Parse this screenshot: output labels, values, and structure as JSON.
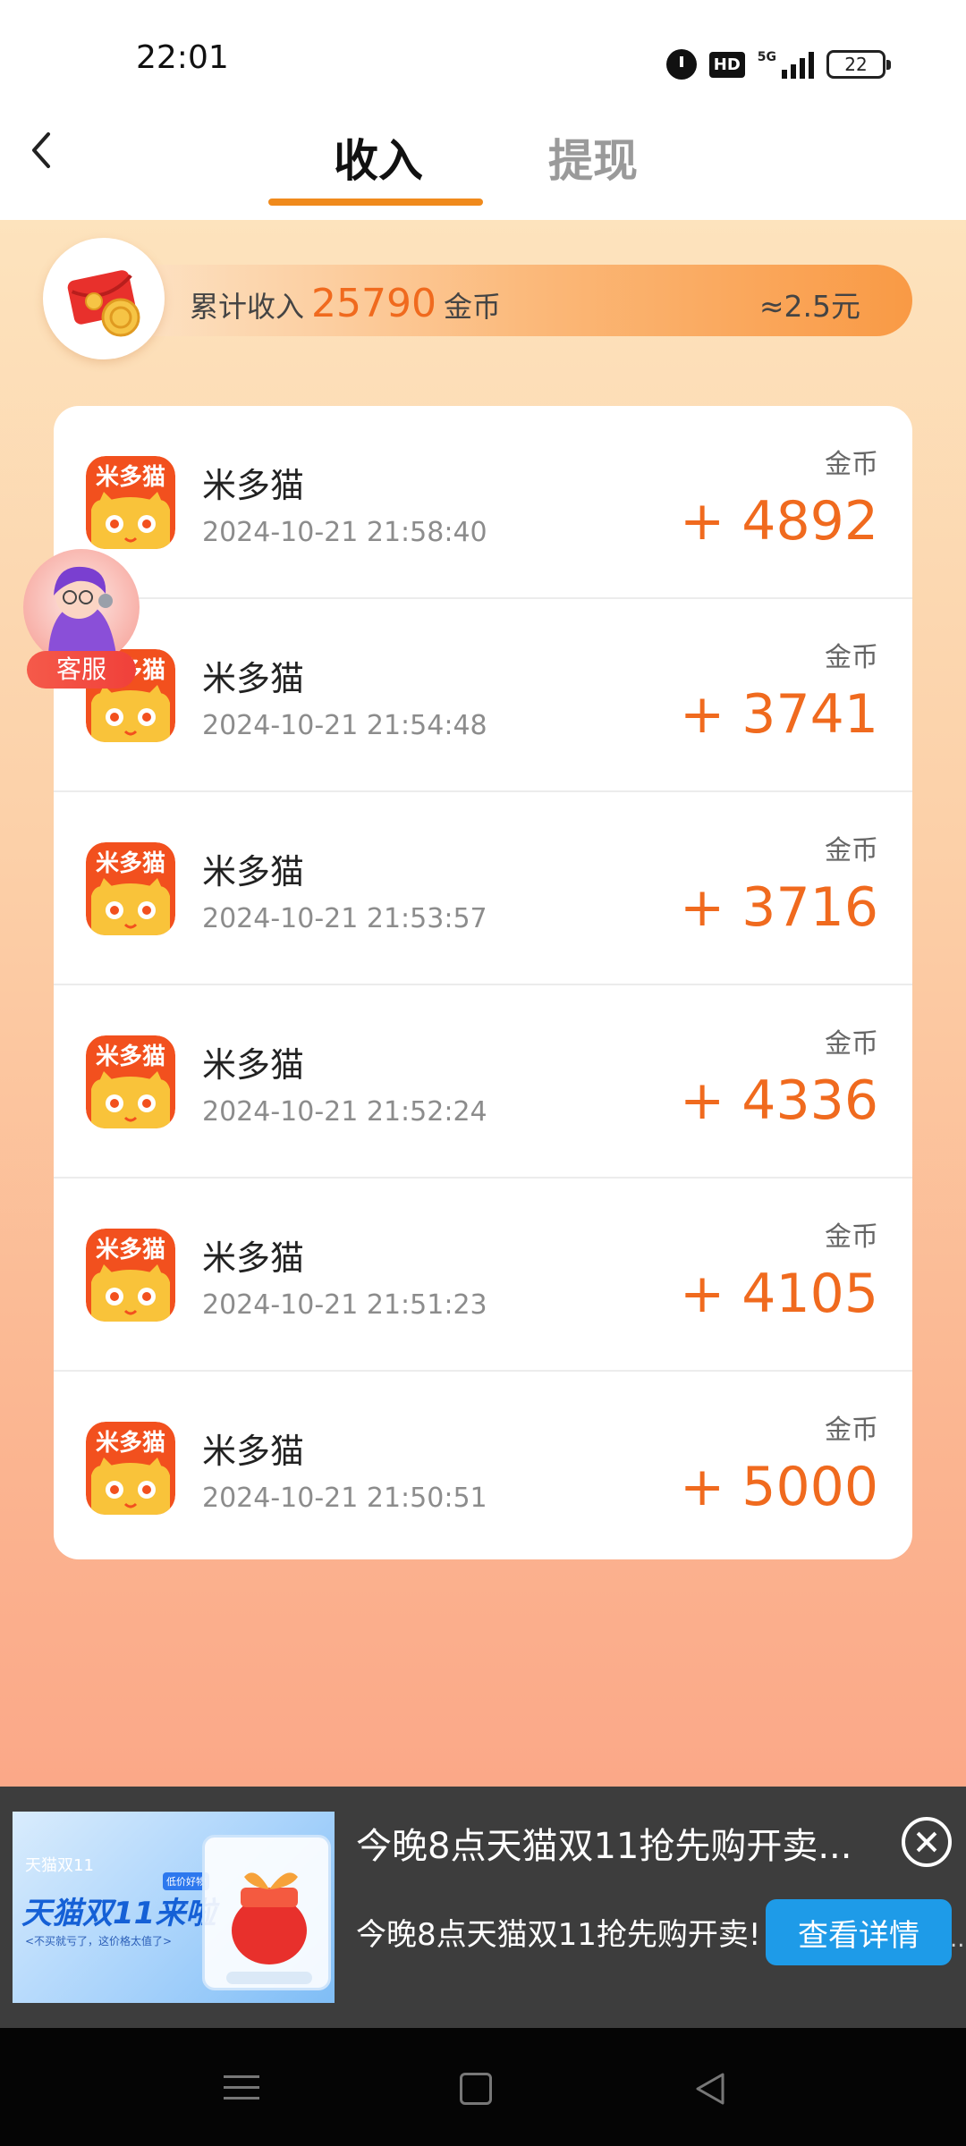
{
  "status_bar": {
    "time": "22:01",
    "network": "5G",
    "hd": "HD",
    "battery": "22"
  },
  "header": {
    "tabs": [
      {
        "label": "收入",
        "active": true
      },
      {
        "label": "提现",
        "active": false
      }
    ]
  },
  "summary": {
    "label": "累计收入",
    "amount": "25790",
    "unit": "金币",
    "approx": "≈2.5元"
  },
  "records": [
    {
      "app": "米多猫",
      "time": "2024-10-21 21:58:40",
      "unit": "金币",
      "amount": "+ 4892"
    },
    {
      "app": "米多猫",
      "time": "2024-10-21 21:54:48",
      "unit": "金币",
      "amount": "+ 3741"
    },
    {
      "app": "米多猫",
      "time": "2024-10-21 21:53:57",
      "unit": "金币",
      "amount": "+ 3716"
    },
    {
      "app": "米多猫",
      "time": "2024-10-21 21:52:24",
      "unit": "金币",
      "amount": "+ 4336"
    },
    {
      "app": "米多猫",
      "time": "2024-10-21 21:51:23",
      "unit": "金币",
      "amount": "+ 4105"
    },
    {
      "app": "米多猫",
      "time": "2024-10-21 21:50:51",
      "unit": "金币",
      "amount": "+ 5000"
    }
  ],
  "app_icon_text": "米多猫",
  "customer_service": {
    "label": "客服"
  },
  "ad": {
    "image_small": "天猫双11",
    "image_big": "天猫双11来啦",
    "image_sub": "<不买就亏了，这价格太值了>",
    "image_tag": "低价好物",
    "title": "今晚8点天猫双11抢先购开卖...",
    "description": "今晚8点天猫双11抢先购开卖!",
    "cta": "查看详情",
    "ellipsis": ".."
  },
  "colors": {
    "accent": "#f06a1e",
    "tab_underline": "#f08a1c",
    "ad_button": "#1e9be8"
  }
}
